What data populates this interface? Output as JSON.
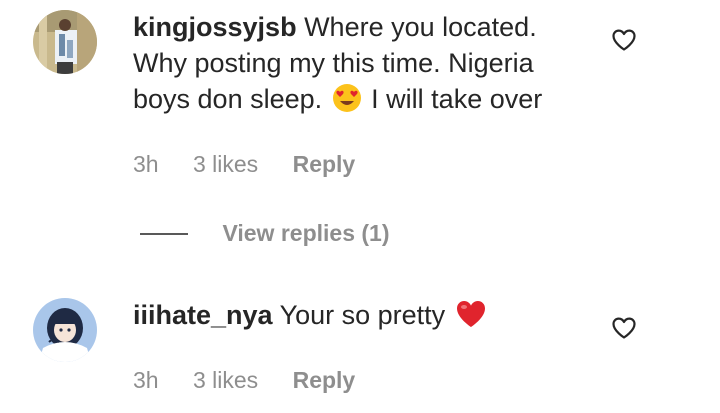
{
  "comments": [
    {
      "username": "kingjossyjsb",
      "text_part1": "Where you located. Why posting my this time. Nigeria boys don sleep.",
      "emoji": "heart-eyes-emoji",
      "text_part2": "I will take over",
      "time": "3h",
      "likes": "3 likes",
      "reply_label": "Reply"
    },
    {
      "username": "iiihate_nya",
      "text_part1": "Your so pretty",
      "emoji": "red-heart-emoji",
      "time": "3h",
      "likes": "3 likes",
      "reply_label": "Reply"
    }
  ],
  "view_replies": {
    "label": "View replies (1)"
  },
  "icons": {
    "like": "heart-outline-icon"
  },
  "colors": {
    "text": "#262626",
    "muted": "#8e8e8e",
    "emoji_heart": "#e0242d",
    "emoji_face": "#fcc21b"
  }
}
